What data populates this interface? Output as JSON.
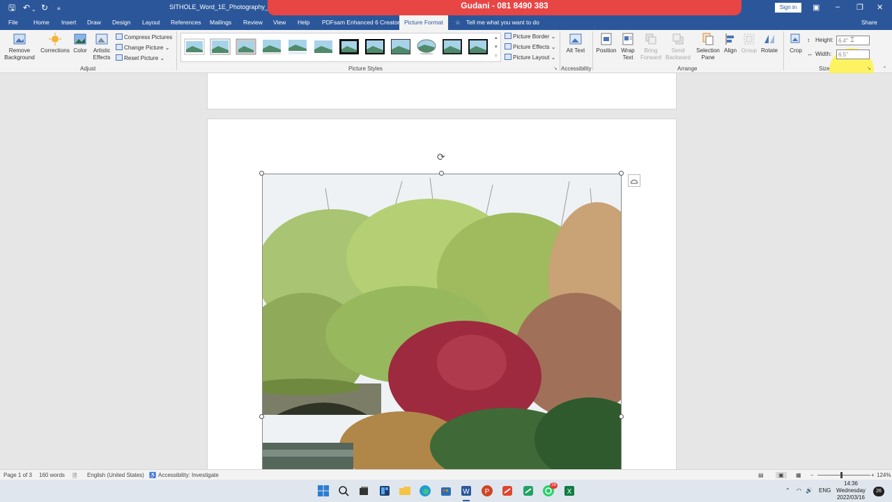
{
  "window": {
    "title": "SITHOLE_Word_1E_Photography_Assista",
    "banner": "Gudani - 081 8490 383",
    "sign_in": "Sign in"
  },
  "tabs": [
    {
      "label": "File"
    },
    {
      "label": "Home"
    },
    {
      "label": "Insert"
    },
    {
      "label": "Draw"
    },
    {
      "label": "Design"
    },
    {
      "label": "Layout"
    },
    {
      "label": "References"
    },
    {
      "label": "Mailings"
    },
    {
      "label": "Review"
    },
    {
      "label": "View"
    },
    {
      "label": "Help"
    },
    {
      "label": "PDFsam Enhanced 6 Creator"
    },
    {
      "label": "Picture Format"
    },
    {
      "label": "Tell me what you want to do"
    }
  ],
  "share_label": "Share",
  "ribbon": {
    "adjust": {
      "remove_background": "Remove Background",
      "corrections": "Corrections",
      "color": "Color",
      "artistic_effects": "Artistic Effects",
      "compress": "Compress Pictures",
      "change": "Change Picture",
      "reset": "Reset Picture",
      "group_label": "Adjust"
    },
    "styles": {
      "border": "Picture Border",
      "effects": "Picture Effects",
      "layout": "Picture Layout",
      "group_label": "Picture Styles"
    },
    "accessibility": {
      "alt_text": "Alt Text",
      "group_label": "Accessibility"
    },
    "arrange": {
      "position": "Position",
      "wrap_text": "Wrap Text",
      "bring_forward": "Bring Forward",
      "send_backward": "Send Backward",
      "selection_pane": "Selection Pane",
      "align": "Align",
      "group": "Group",
      "rotate": "Rotate",
      "group_label": "Arrange"
    },
    "size": {
      "crop": "Crop",
      "height_label": "Height:",
      "height_value": "6.4\"",
      "width_label": "Width:",
      "width_value": "6.5\"",
      "group_label": "Size"
    }
  },
  "status": {
    "page": "Page 1 of 3",
    "words": "160 words",
    "language": "English (United States)",
    "accessibility": "Accessibility: Investigate",
    "zoom": "124%"
  },
  "taskbar": {
    "lang": "ENG",
    "time": "14:36",
    "day": "Wednesday",
    "date": "2022/03/16",
    "whatsapp_badge": "28",
    "notif_count": "26"
  }
}
